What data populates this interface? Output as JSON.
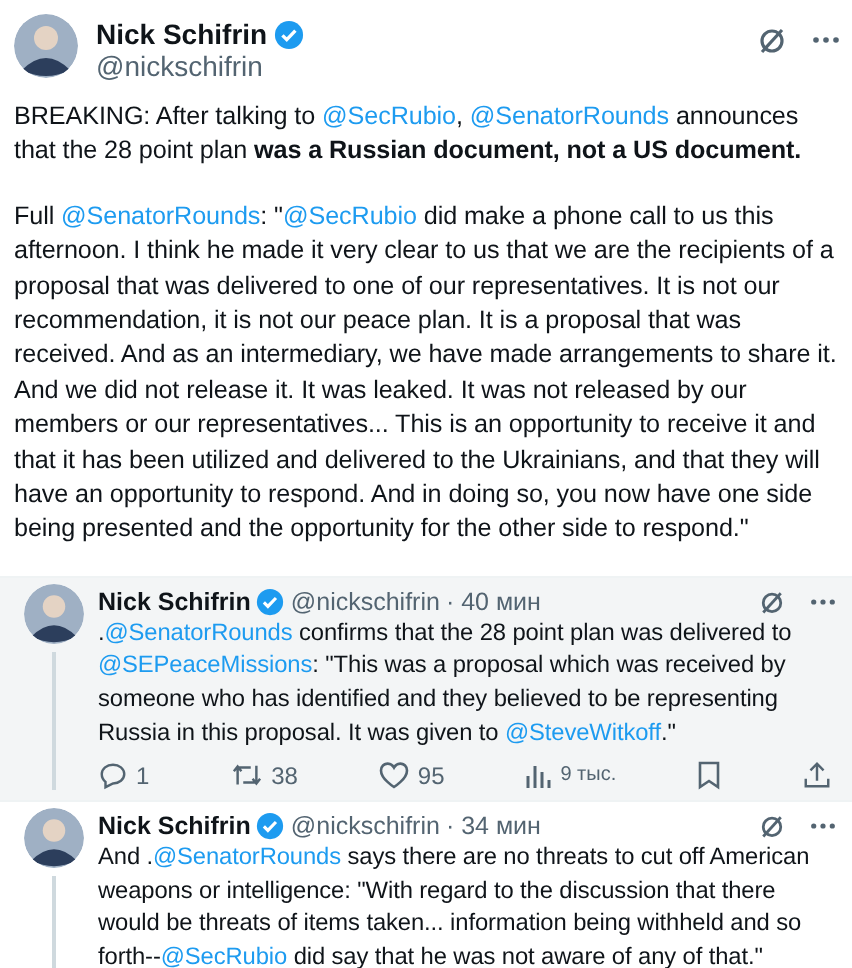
{
  "main_tweet": {
    "author": "Nick Schifrin",
    "verified": true,
    "handle": "@nickschifrin",
    "paragraphs": [
      [
        {
          "kind": "text",
          "text": "BREAKING: After talking to "
        },
        {
          "kind": "mention",
          "text": "@SecRubio"
        },
        {
          "kind": "text",
          "text": ", "
        },
        {
          "kind": "mention",
          "text": "@SenatorRounds"
        },
        {
          "kind": "text",
          "text": " announces that the 28 point plan **was a Russian document, not a US document.**"
        }
      ],
      [
        {
          "kind": "text",
          "text": "Full "
        },
        {
          "kind": "mention",
          "text": "@SenatorRounds"
        },
        {
          "kind": "text",
          "text": ": \""
        },
        {
          "kind": "mention",
          "text": "@SecRubio"
        },
        {
          "kind": "text",
          "text": " did make a phone call to us this afternoon. I think he made it very clear to us that we are the recipients of a proposal that was delivered to one of our representatives. It is not our recommendation, it is not our peace plan. It is a proposal that was received. And as an intermediary, we have made arrangements to share it. And we did not release it. It was leaked. It was not released by our members or our representatives... This is an opportunity to receive it and that it has been utilized and delivered to the Ukrainians, and that they will have an opportunity to respond. And in doing so, you now have one side being presented and the opportunity for the other side to respond.\""
        }
      ]
    ]
  },
  "replies": [
    {
      "author": "Nick Schifrin",
      "verified": true,
      "handle": "@nickschifrin",
      "time": "· 40 мин",
      "highlighted": true,
      "segments": [
        {
          "kind": "text",
          "text": "."
        },
        {
          "kind": "mention",
          "text": "@SenatorRounds"
        },
        {
          "kind": "text",
          "text": " confirms that the 28 point plan was delivered to "
        },
        {
          "kind": "mention",
          "text": "@SEPeaceMissions"
        },
        {
          "kind": "text",
          "text": ": \"This was a proposal which was received by someone who has identified and they believed to be representing Russia in this proposal. It was given to "
        },
        {
          "kind": "mention",
          "text": "@SteveWitkoff"
        },
        {
          "kind": "text",
          "text": ".\""
        }
      ],
      "actions": [
        {
          "kind": "reply",
          "count": "1"
        },
        {
          "kind": "retweet",
          "count": "38"
        },
        {
          "kind": "like",
          "count": "95"
        },
        {
          "kind": "views",
          "count": "9 тыс."
        },
        {
          "kind": "bookmark"
        },
        {
          "kind": "share"
        }
      ]
    },
    {
      "author": "Nick Schifrin",
      "verified": true,
      "handle": "@nickschifrin",
      "time": "· 34 мин",
      "highlighted": false,
      "segments": [
        {
          "kind": "text",
          "text": "And ."
        },
        {
          "kind": "mention",
          "text": "@SenatorRounds"
        },
        {
          "kind": "text",
          "text": " says there are no threats to cut off American weapons or intelligence: \"With regard to the discussion that there would be threats of items taken... information being withheld and so forth--"
        },
        {
          "kind": "mention",
          "text": "@SecRubio"
        },
        {
          "kind": "text",
          "text": " did say that he was not aware of any of that.\""
        }
      ]
    }
  ]
}
